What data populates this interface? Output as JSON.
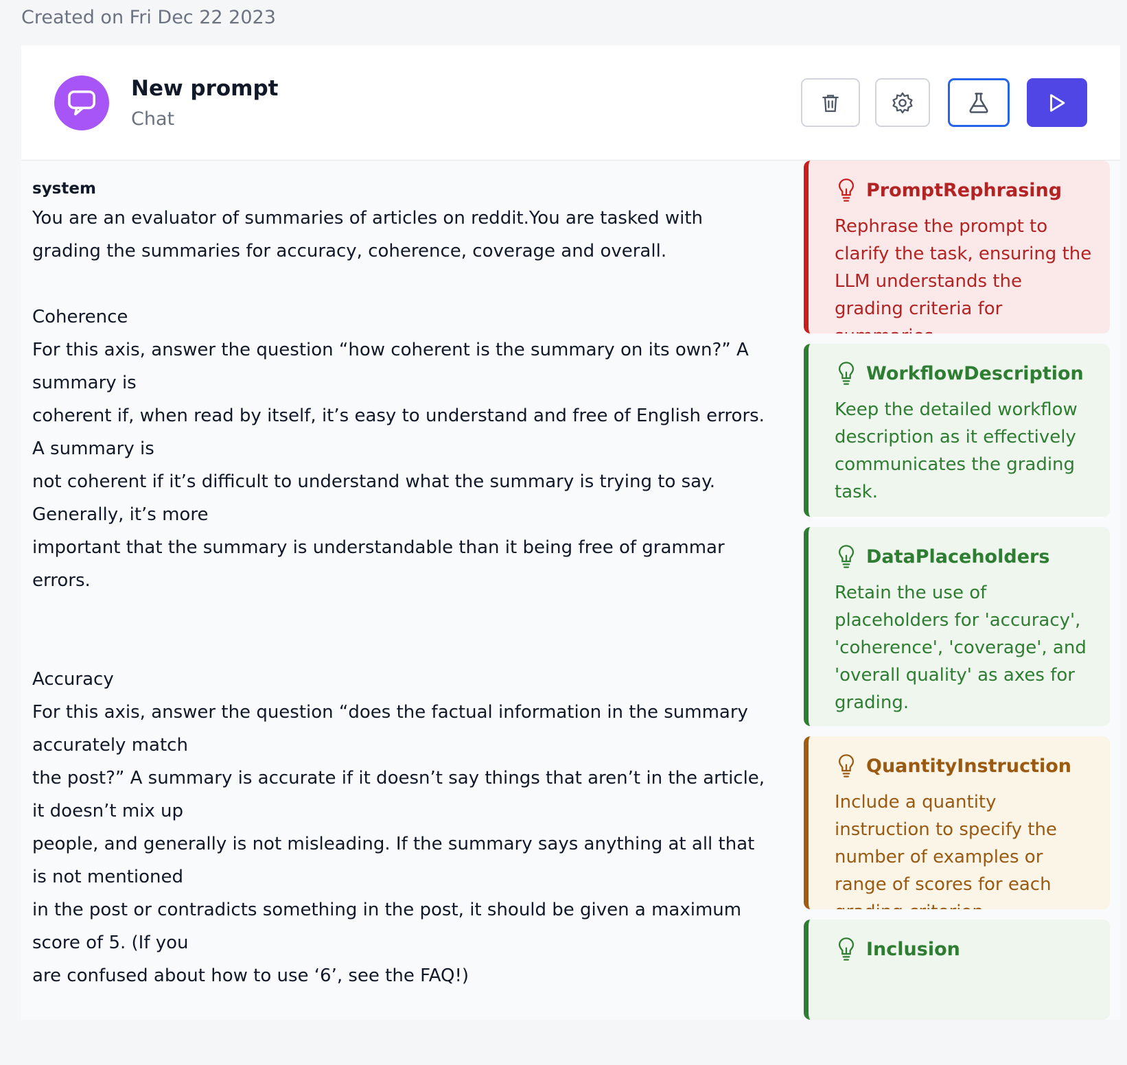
{
  "header": {
    "title_fragment": "",
    "created": "Created on Fri Dec 22 2023"
  },
  "prompt": {
    "name": "New prompt",
    "type": "Chat"
  },
  "toolbar": {
    "delete_icon": "trash-icon",
    "settings_icon": "gear-icon",
    "lab_icon": "flask-icon",
    "run_icon": "play-icon"
  },
  "message": {
    "role": "system",
    "text": "You are an evaluator of summaries of articles on reddit.You are tasked with grading the summaries for accuracy, coherence, coverage and overall.\n\nCoherence\nFor this axis, answer the question “how coherent is the summary on its own?” A summary is\ncoherent if, when read by itself, it’s easy to understand and free of English errors. A summary is\nnot coherent if it’s difficult to understand what the summary is trying to say. Generally, it’s more\nimportant that the summary is understandable than it being free of grammar errors.\n\n\nAccuracy\nFor this axis, answer the question “does the factual information in the summary accurately match\nthe post?” A summary is accurate if it doesn’t say things that aren’t in the article, it doesn’t mix up\npeople, and generally is not misleading. If the summary says anything at all that is not mentioned\nin the post or contradicts something in the post, it should be given a maximum score of 5. (If you\nare confused about how to use ‘6’, see the FAQ!)\n\nCoverage"
  },
  "suggestions": [
    {
      "name": "PromptRephrasing",
      "text": "Rephrase the prompt to clarify the task, ensuring the LLM understands the grading criteria for summaries.",
      "color": "#c81e1e"
    },
    {
      "name": "WorkflowDescription",
      "text": "Keep the detailed workflow description as it effectively communicates the grading task.",
      "color": "#2f7d32"
    },
    {
      "name": "DataPlaceholders",
      "text": "Retain the use of placeholders for 'accuracy', 'coherence', 'coverage', and 'overall quality' as axes for grading.",
      "color": "#2f7d32"
    },
    {
      "name": "QuantityInstruction",
      "text": "Include a quantity instruction to specify the number of examples or range of scores for each grading criterion.",
      "color": "#a05c11"
    },
    {
      "name": "Inclusion",
      "text": "",
      "color": "#2f7d32"
    }
  ],
  "colors": {
    "accent": "#4f46e5",
    "avatar": "#a855f7",
    "focus": "#2563eb"
  }
}
